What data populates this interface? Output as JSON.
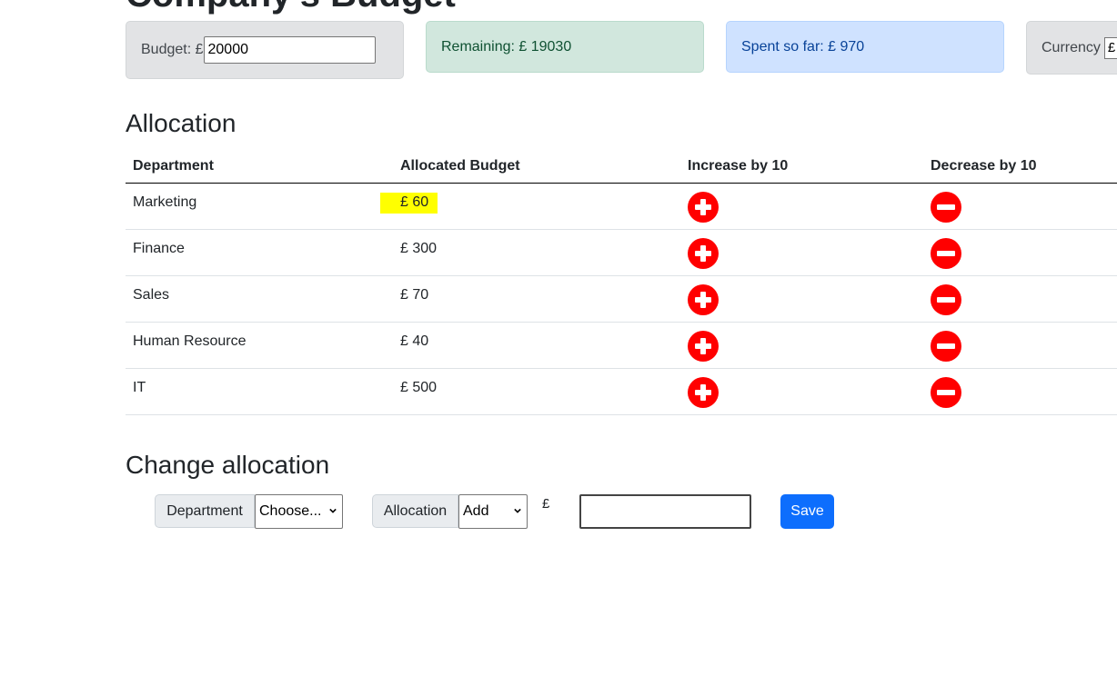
{
  "header": {
    "title_partial": "Company's Budget"
  },
  "cards": {
    "budget": {
      "label": "Budget: £",
      "value": "20000"
    },
    "remaining": {
      "text": "Remaining: £ 19030"
    },
    "spent": {
      "text": "Spent so far: £ 970"
    },
    "currency": {
      "label": "Currency",
      "value": "£"
    }
  },
  "allocation": {
    "heading": "Allocation",
    "columns": [
      "Department",
      "Allocated Budget",
      "Increase by 10",
      "Decrease by 10"
    ],
    "rows": [
      {
        "department": "Marketing",
        "budget": "£ 60",
        "highlighted": true
      },
      {
        "department": "Finance",
        "budget": "£ 300"
      },
      {
        "department": "Sales",
        "budget": "£ 70"
      },
      {
        "department": "Human Resource",
        "budget": "£ 40"
      },
      {
        "department": "IT",
        "budget": "£ 500"
      }
    ]
  },
  "change_allocation": {
    "heading": "Change allocation",
    "department_label": "Department",
    "department_selected": "Choose...",
    "allocation_label": "Allocation",
    "allocation_selected": "Add",
    "currency_symbol": "£",
    "amount_value": "",
    "save_label": "Save"
  },
  "colors": {
    "increase_icon": "#ff0000",
    "decrease_icon": "#ff0000",
    "save_button": "#0d6efd",
    "highlight": "#ffff00"
  }
}
